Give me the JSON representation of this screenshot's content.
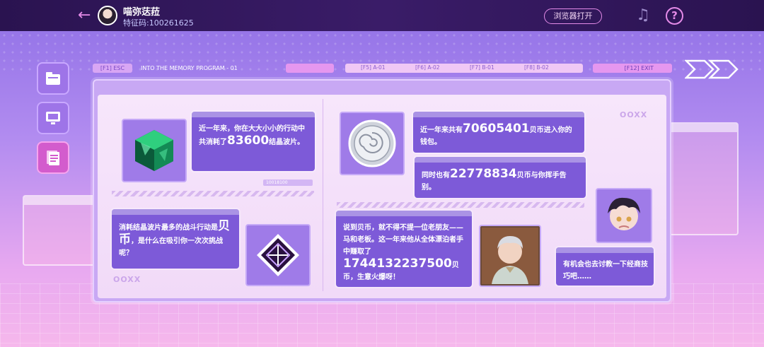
{
  "topbar": {
    "back_icon": "arrow-left-icon",
    "username": "喵弥荙菈",
    "id_label": "特征码:",
    "id_value": "100261625",
    "browser_button": "浏览器打开",
    "music_icon": "music-note-icon",
    "help_icon": "question-mark-icon"
  },
  "sidebar": {
    "items": [
      {
        "icon": "folder-icon"
      },
      {
        "icon": "monitor-icon"
      },
      {
        "icon": "document-icon",
        "active": true
      }
    ]
  },
  "strip": {
    "esc": "[F1] ESC",
    "title": "INTO THE MEMORY PROGRAM - 01",
    "f5": "[F5] A-01",
    "f6": "[F6] A-02",
    "f7": "[F7] B-01",
    "f8": "[F8] B-02",
    "f12": "[F12] EXIT"
  },
  "left_panel": {
    "card1": {
      "text_a": "近一年来，你在大大小小的行动中共消耗了",
      "number": "83600",
      "text_b": "结晶波片。"
    },
    "card2": {
      "text_a": "消耗结晶波片最多的战斗行动是",
      "highlight": "贝币",
      "text_b": "，是什么在吸引你一次次挑战呢？"
    },
    "oox": "OOXX",
    "bar_text": "10018100"
  },
  "right_panel": {
    "card1": {
      "text_a": "近一年来共有",
      "number": "70605401",
      "text_b": "贝币进入你的钱包。"
    },
    "card2": {
      "text_a": "同时也有",
      "number": "22778834",
      "text_b": "贝币与你挥手告别。"
    },
    "card3": {
      "text_a": "说到贝币，就不得不提一位老朋友——马和老板。这一年来他从全体漂泊者手中赚取了",
      "number": "1744132237500",
      "text_b": "贝币，生意火爆呀！"
    },
    "card4": {
      "text": "有机会也去讨教一下经商技巧吧……"
    },
    "oox": "OOXX"
  },
  "colors": {
    "accent": "#e48be8",
    "card": "#7d5ad8",
    "topbar": "#2a1350"
  }
}
